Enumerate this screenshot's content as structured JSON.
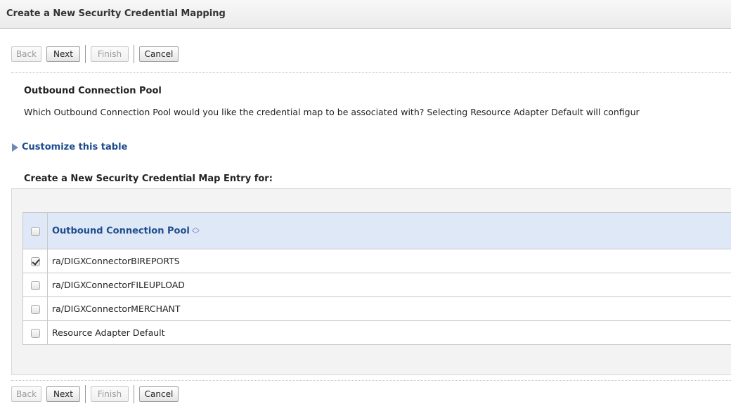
{
  "page": {
    "title": "Create a New Security Credential Mapping"
  },
  "wizard": {
    "back": "Back",
    "next": "Next",
    "finish": "Finish",
    "cancel": "Cancel"
  },
  "section": {
    "heading": "Outbound Connection Pool",
    "description": "Which Outbound Connection Pool would you like the credential map to be associated with? Selecting Resource Adapter Default will configur"
  },
  "customize": {
    "label": "Customize this table"
  },
  "entry": {
    "heading": "Create a New Security Credential Map Entry for:"
  },
  "table": {
    "column_header": "Outbound Connection Pool",
    "rows": [
      {
        "name": "ra/DIGXConnectorBIREPORTS",
        "checked": true
      },
      {
        "name": "ra/DIGXConnectorFILEUPLOAD",
        "checked": false
      },
      {
        "name": "ra/DIGXConnectorMERCHANT",
        "checked": false
      },
      {
        "name": "Resource Adapter Default",
        "checked": false
      }
    ]
  },
  "icons": {
    "sort": "sort-ascending-icon",
    "expand": "expand-triangle-icon",
    "checkbox": "checkbox-icon"
  },
  "colors": {
    "link": "#1d4c8c",
    "header_bg": "#dfe8f7",
    "panel_bg": "#f3f3f3"
  }
}
